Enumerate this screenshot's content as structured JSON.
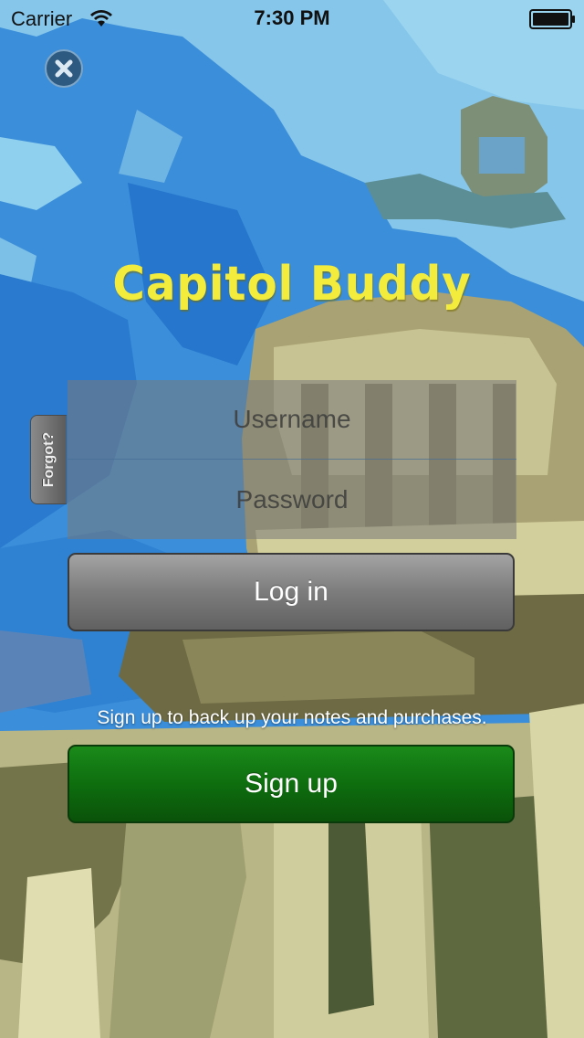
{
  "status_bar": {
    "carrier": "Carrier",
    "time": "7:30 PM",
    "wifi_icon": "wifi-icon",
    "battery_icon": "battery-icon"
  },
  "close_icon": "close-icon",
  "app_title": "Capitol Buddy",
  "forgot_tab": {
    "label": "Forgot?"
  },
  "login_form": {
    "username_placeholder": "Username",
    "username_value": "",
    "password_placeholder": "Password",
    "password_value": ""
  },
  "login_button": {
    "label": "Log in"
  },
  "signup": {
    "hint": "Sign up to back up your notes and purchases.",
    "button_label": "Sign up"
  },
  "colors": {
    "title": "#f4ec3c",
    "login_button": "#7c7c7c",
    "signup_button": "#0e6e0e",
    "sky": "#3a8fd8"
  }
}
